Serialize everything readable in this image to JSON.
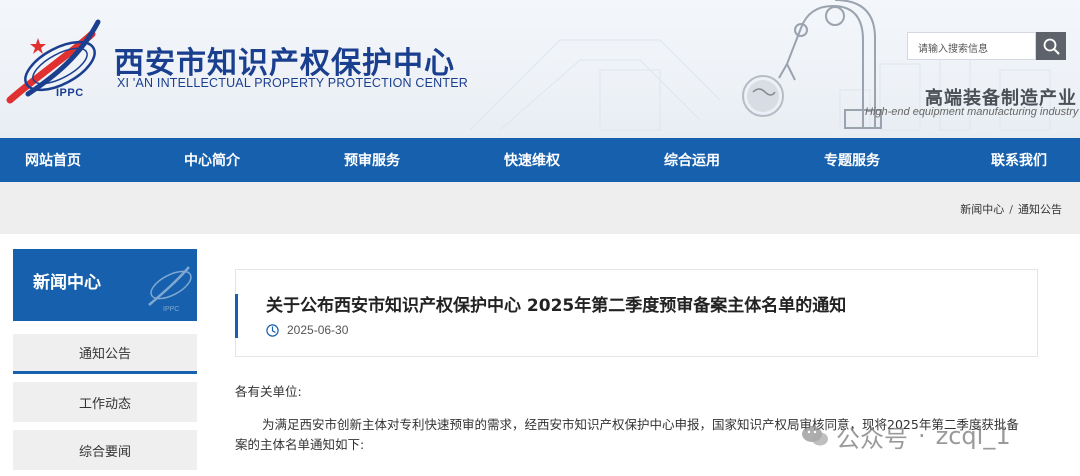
{
  "header": {
    "title": "西安市知识产权保护中心",
    "subtitle": "XI 'AN INTELLECTUAL PROPERTY PROTECTION CENTER",
    "logo_text": "IPPC",
    "search": {
      "placeholder": "请输入搜索信息",
      "icon": "search-icon"
    },
    "industry_title": "高端装备制造产业",
    "industry_subtitle": "High-end equipment manufacturing industry"
  },
  "nav": {
    "items": [
      {
        "label": "网站首页"
      },
      {
        "label": "中心简介"
      },
      {
        "label": "预审服务"
      },
      {
        "label": "快速维权"
      },
      {
        "label": "综合运用"
      },
      {
        "label": "专题服务"
      },
      {
        "label": "联系我们"
      }
    ]
  },
  "breadcrumb": {
    "items": [
      "新闻中心",
      "通知公告"
    ],
    "separator": "/"
  },
  "sidebar": {
    "title": "新闻中心",
    "logo_text": "IPPC",
    "items": [
      {
        "label": "通知公告",
        "active": true
      },
      {
        "label": "工作动态",
        "active": false
      },
      {
        "label": "综合要闻",
        "active": false
      }
    ]
  },
  "article": {
    "title": "关于公布西安市知识产权保护中心 2025年第二季度预审备案主体名单的通知",
    "date_icon": "clock-icon",
    "date": "2025-06-30",
    "greeting": "各有关单位:",
    "paragraph_line1": "为满足西安市创新主体对专利快速预审的需求，经西安市知识产权保护中心申报，国家知识产权局审核同意，现将2025年第二季度获批备",
    "paragraph_line2": "案的主体名单通知如下:"
  },
  "watermark": {
    "platform": "公众号",
    "dot": "·",
    "account": "zcql_1",
    "icon": "wechat-icon"
  },
  "colors": {
    "brand_blue": "#1760ad",
    "title_blue": "#1a3f8f",
    "logo_red": "#e03030",
    "strip_gray": "#eeeeee"
  }
}
